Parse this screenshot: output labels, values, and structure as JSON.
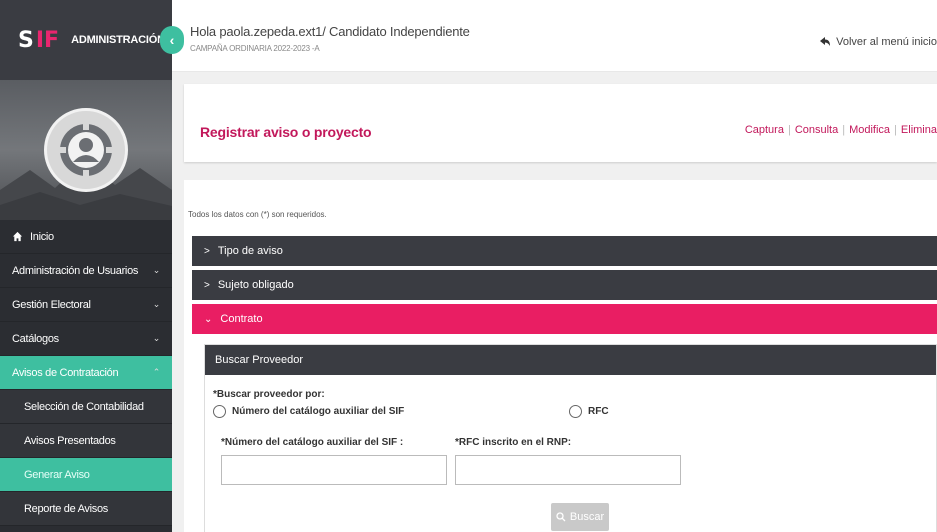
{
  "brand": {
    "logo_s": "S",
    "logo_if": "IF",
    "title": "ADMINISTRACIÓN"
  },
  "header": {
    "greeting": "Hola paola.zepeda.ext1/ Candidato Independiente",
    "campaign": "CAMPAÑA ORDINARIA 2022-2023 -A",
    "back_link": "Volver al menú inicio"
  },
  "sidebar": {
    "items": [
      {
        "label": "Inicio",
        "icon": "home-icon"
      },
      {
        "label": "Administración de Usuarios",
        "chevron": "⌄"
      },
      {
        "label": "Gestión Electoral",
        "chevron": "⌄"
      },
      {
        "label": "Catálogos",
        "chevron": "⌄"
      },
      {
        "label": "Avisos de Contratación",
        "chevron": "⌃"
      }
    ],
    "subitems": [
      {
        "label": "Selección de Contabilidad"
      },
      {
        "label": "Avisos Presentados"
      },
      {
        "label": "Generar Aviso"
      },
      {
        "label": "Reporte de Avisos"
      }
    ]
  },
  "page": {
    "title": "Registrar aviso o proyecto",
    "actions": [
      "Captura",
      "Consulta",
      "Modifica",
      "Elimina"
    ],
    "required_note": "Todos los datos con (*) son requeridos."
  },
  "panels": [
    {
      "label": "Tipo de aviso",
      "caret": ">"
    },
    {
      "label": "Sujeto obligado",
      "caret": ">"
    },
    {
      "label": "Contrato",
      "caret": "⌄"
    }
  ],
  "provider_search": {
    "header": "Buscar Proveedor",
    "search_by_label": "*Buscar proveedor por:",
    "option_catalog": "Número del catálogo auxiliar del SIF",
    "option_rfc": "RFC",
    "catalog_field_label": "*Número del catálogo auxiliar del SIF :",
    "rfc_field_label": "*RFC inscrito en el RNP:",
    "catalog_value": "",
    "rfc_value": "",
    "search_button": "Buscar"
  },
  "colors": {
    "accent": "#e91e63",
    "teal": "#3ebfa0",
    "dark": "#3a3c42"
  }
}
